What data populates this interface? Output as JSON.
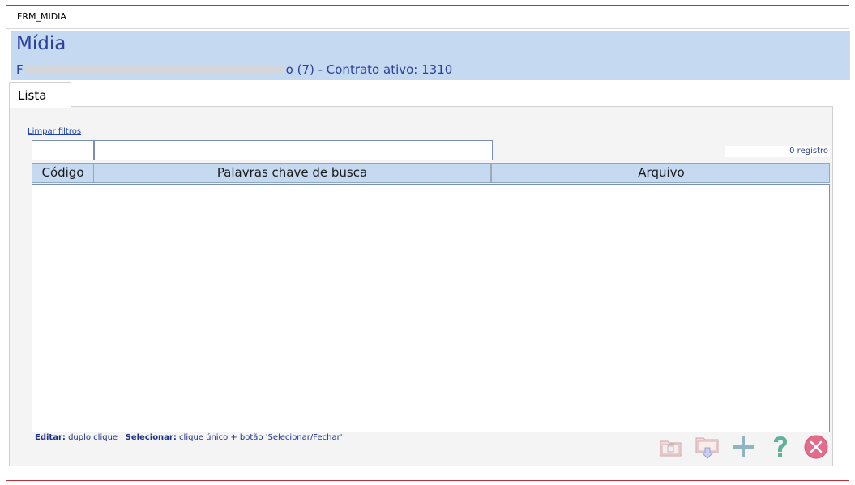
{
  "window": {
    "title": "FRM_MIDIA"
  },
  "header": {
    "title": "Mídia",
    "subtitle_prefix": "F",
    "subtitle_suffix": "o (7) - Contrato ativo: 1310"
  },
  "tabs": [
    {
      "label": "Lista"
    }
  ],
  "filters": {
    "clear_label": "Limpar filtros",
    "codigo_value": "",
    "palavras_value": ""
  },
  "record_count": "0 registro",
  "table": {
    "columns": [
      "Código",
      "Palavras chave de busca",
      "Arquivo"
    ],
    "rows": []
  },
  "hints": {
    "edit_label": "Editar:",
    "edit_text": "duplo clique",
    "select_label": "Selecionar:",
    "select_text": "clique único + botão 'Selecionar/Fechar'"
  },
  "toolbar": {
    "buttons": [
      {
        "icon": "folder-open-icon"
      },
      {
        "icon": "folder-download-icon"
      },
      {
        "icon": "add-plus-icon"
      },
      {
        "icon": "help-question-icon"
      },
      {
        "icon": "close-circle-icon"
      }
    ]
  },
  "colors": {
    "header_bg": "#c5d9f1",
    "title_text": "#2b3f9e",
    "close_button": "#e46c8a",
    "help_green": "#5fb19a",
    "window_border": "#c0303a"
  }
}
